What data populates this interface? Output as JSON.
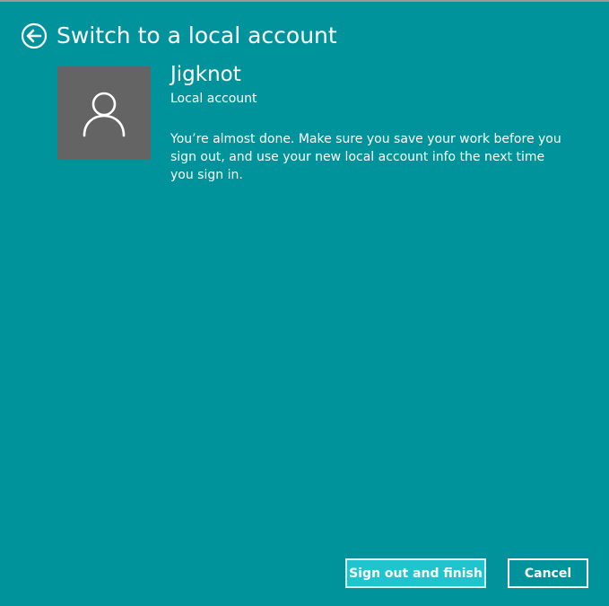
{
  "header": {
    "back_icon": "arrow-left-circle-icon",
    "title": "Switch to a local account"
  },
  "account": {
    "avatar_icon": "user-silhouette-icon",
    "name": "Jigknot",
    "type": "Local account",
    "message": "You’re almost done. Make sure you save your work before you sign out, and use your new local account info the next time you sign in."
  },
  "buttons": {
    "primary_label": "Sign out and finish",
    "cancel_label": "Cancel"
  },
  "colors": {
    "background": "#00939b",
    "avatar_background": "#646464",
    "primary_button": "#20c4ce",
    "text": "#ffffff"
  }
}
